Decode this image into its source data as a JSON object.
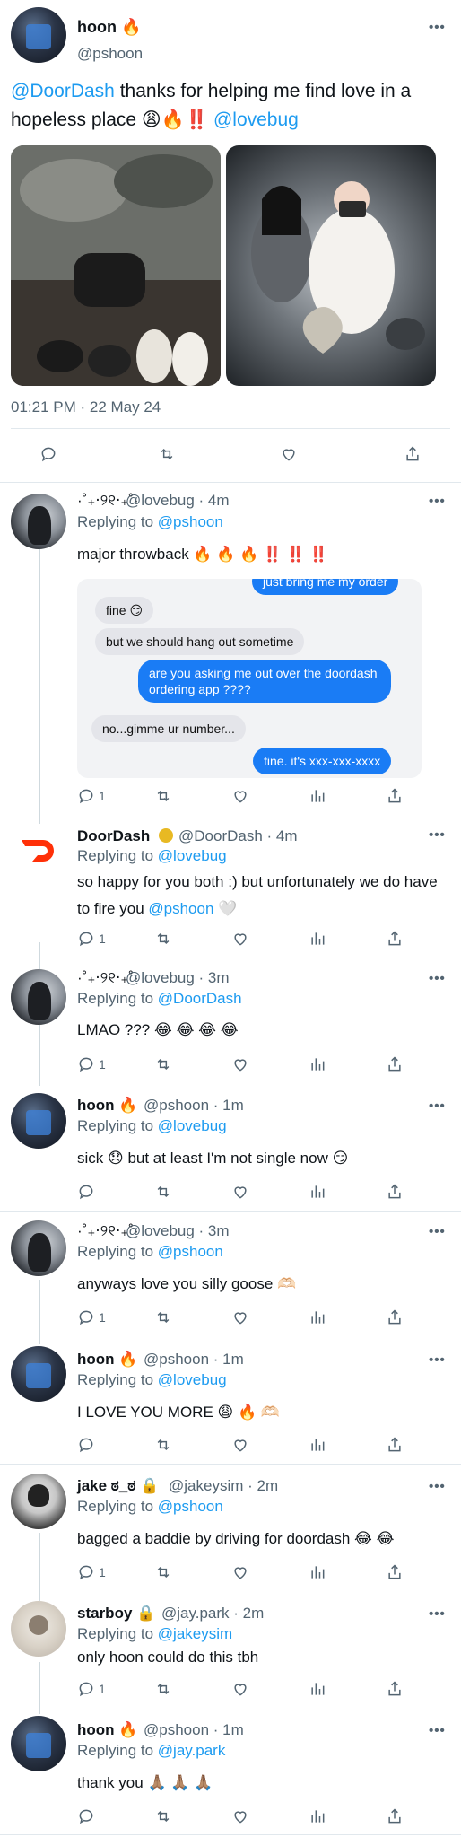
{
  "main_tweet": {
    "name": "hoon 🔥",
    "handle": "@pshoon",
    "text_mention": "@DoorDash",
    "text_body": " thanks for helping me find love in a hopeless place 😩🔥‼️ ",
    "text_mention2": "@lovebug",
    "timestamp": "01:21 PM · 22 May 24"
  },
  "replies": [
    {
      "name": "·˚₊‧୨୧‧₊˚·",
      "handle": "@lovebug · 4m",
      "replying_label": "Replying to",
      "replying_to": "@pshoon",
      "text": "major throwback 🔥 🔥 🔥 ‼️ ‼️ ‼️",
      "reply_count": "1"
    },
    {
      "name": "DoorDash",
      "handle": "@DoorDash · 4m",
      "replying_label": "Replying to",
      "replying_to": "@lovebug",
      "text_a": "so happy for you both :) but unfortunately we do have to fire you ",
      "text_mention": "@pshoon",
      "text_b": " 🤍",
      "reply_count": "1"
    },
    {
      "name": "·˚₊‧୨୧‧₊˚·",
      "handle": "@lovebug · 3m",
      "replying_label": "Replying to",
      "replying_to": "@DoorDash",
      "text": "LMAO ??? 😂 😂 😂 😂",
      "reply_count": "1"
    },
    {
      "name": "hoon 🔥",
      "handle": "@pshoon · 1m",
      "replying_label": "Replying to",
      "replying_to": "@lovebug",
      "text": "sick 😞  but at least I'm not single now 😏",
      "reply_count": ""
    },
    {
      "name": "·˚₊‧୨୧‧₊˚·",
      "handle": "@lovebug · 3m",
      "replying_label": "Replying to",
      "replying_to": "@pshoon",
      "text": "anyways love you silly goose 🫶🏻",
      "reply_count": "1"
    },
    {
      "name": "hoon 🔥",
      "handle": "@pshoon · 1m",
      "replying_label": "Replying to",
      "replying_to": "@lovebug",
      "text": "I LOVE YOU MORE 😩 🔥 🫶🏻",
      "reply_count": ""
    },
    {
      "name": "jake ಠ_ಠ 🔒",
      "handle": "@jakeysim · 2m",
      "replying_label": "Replying to",
      "replying_to": "@pshoon",
      "text": "bagged a baddie by driving for doordash 😂 😂",
      "reply_count": "1"
    },
    {
      "name": "starboy 🔒",
      "handle": "@jay.park · 2m",
      "replying_label": "Replying to",
      "replying_to": "@jakeysim",
      "text": "only hoon could do this tbh",
      "reply_count": "1"
    },
    {
      "name": "hoon 🔥",
      "handle": "@pshoon · 1m",
      "replying_label": "Replying to",
      "replying_to": "@jay.park",
      "text": "thank you 🙏🏽 🙏🏽 🙏🏽",
      "reply_count": ""
    }
  ],
  "chat": {
    "top_cut": "just bring me my order",
    "messages": [
      {
        "side": "in",
        "text": "fine 😏"
      },
      {
        "side": "in",
        "text": "but we should hang out sometime"
      },
      {
        "side": "out",
        "text": "are you asking me out over the doordash"
      },
      {
        "side": "out",
        "text": "ordering app ????"
      },
      {
        "side": "in",
        "text": "no...gimme ur number..."
      },
      {
        "side": "out",
        "text": "fine. it's xxx-xxx-xxxx"
      }
    ]
  },
  "more_glyph": "•••",
  "colors": {
    "link": "#1d9bf0",
    "muted": "#536471",
    "doordash": "#ff3008"
  }
}
